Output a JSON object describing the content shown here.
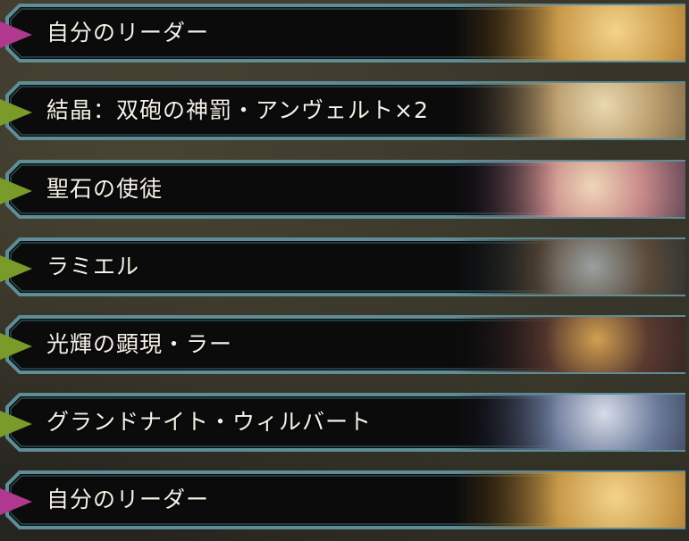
{
  "deck_list": {
    "items": [
      {
        "label": "自分のリーダー",
        "kind": "leader",
        "accent": "#b0388f",
        "portrait_tone": [
          "#6a4a1c",
          "#c99a4a",
          "#f3d38a"
        ]
      },
      {
        "label": "結晶：双砲の神罰・アンヴェルト×2",
        "kind": "card",
        "accent": "#7a9a2a",
        "portrait_tone": [
          "#4a4030",
          "#b89a6a",
          "#e8d8b0"
        ]
      },
      {
        "label": "聖石の使徒",
        "kind": "card",
        "accent": "#7a9a2a",
        "portrait_tone": [
          "#3a2a40",
          "#c88a8a",
          "#f0d6b8"
        ]
      },
      {
        "label": "ラミエル",
        "kind": "card",
        "accent": "#7a9a2a",
        "portrait_tone": [
          "#1e2a2e",
          "#5a4a3a",
          "#9aa0a0"
        ]
      },
      {
        "label": "光輝の顕現・ラー",
        "kind": "card",
        "accent": "#7a9a2a",
        "portrait_tone": [
          "#201a1c",
          "#5a3a30",
          "#d0a050"
        ]
      },
      {
        "label": "グランドナイト・ウィルバート",
        "kind": "card",
        "accent": "#7a9a2a",
        "portrait_tone": [
          "#1c2030",
          "#6a7a9a",
          "#d8dce8"
        ]
      },
      {
        "label": "自分のリーダー",
        "kind": "leader",
        "accent": "#b0388f",
        "portrait_tone": [
          "#6a4a1c",
          "#c99a4a",
          "#f3d38a"
        ]
      }
    ]
  },
  "colors": {
    "panel_fill": "#0b0b0c",
    "panel_border": "#5f8d96",
    "panel_border_inner": "#2b4a52",
    "leader_arrow": "#b0388f",
    "card_arrow": "#7a9a2a"
  }
}
